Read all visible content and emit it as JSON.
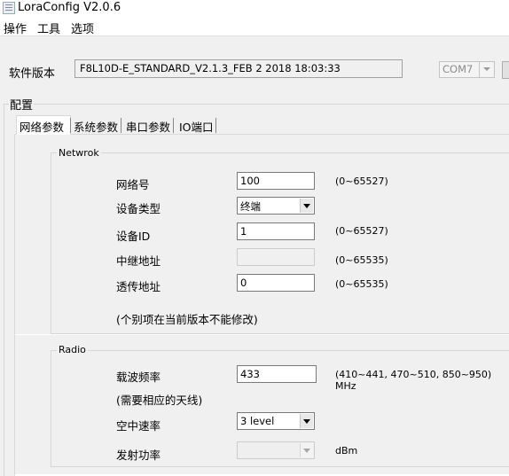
{
  "window": {
    "title": "LoraConfig V2.0.6"
  },
  "menu": {
    "items": [
      "操作",
      "工具",
      "选项"
    ]
  },
  "version": {
    "label": "软件版本",
    "value": "F8L10D-E_STANDARD_V2.1.3_FEB  2 2018 18:03:33"
  },
  "com": {
    "selected": "COM7"
  },
  "config": {
    "legend": "配置",
    "tabs": [
      "网络参数",
      "系统参数",
      "串口参数",
      "IO端口"
    ]
  },
  "network": {
    "legend": "Netwrok",
    "net_id": {
      "label": "网络号",
      "value": "100",
      "hint": "(0~65527)"
    },
    "device_type": {
      "label": "设备类型",
      "value": "终端"
    },
    "device_id": {
      "label": "设备ID",
      "value": "1",
      "hint": "(0~65527)"
    },
    "relay_addr": {
      "label": "中继地址",
      "value": "",
      "hint": "(0~65535)"
    },
    "transparent_addr": {
      "label": "透传地址",
      "value": "0",
      "hint": "(0~65535)"
    },
    "note": "(个别项在当前版本不能修改)"
  },
  "radio": {
    "legend": "Radio",
    "freq": {
      "label": "载波频率",
      "value": "433",
      "hint": "(410~441, 470~510, 850~950)  MHz"
    },
    "antenna_note": "(需要相应的天线)",
    "air_rate": {
      "label": "空中速率",
      "value": "3 level"
    },
    "tx_power": {
      "label": "发射功率",
      "value": "",
      "unit": "dBm"
    }
  }
}
